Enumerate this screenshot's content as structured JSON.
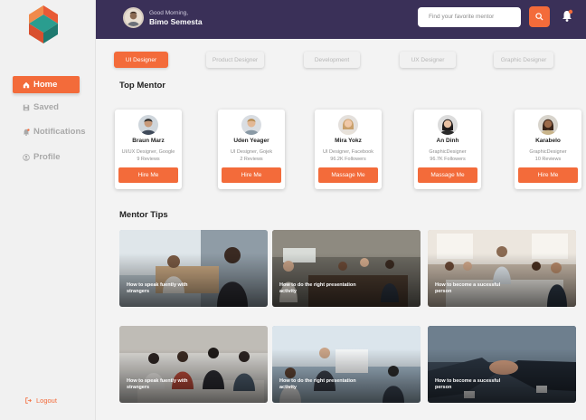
{
  "header": {
    "greeting": "Good Morning,",
    "user_name": "Bimo Semesta",
    "search_placeholder": "Find your favorite mentor"
  },
  "sidebar": {
    "items": [
      {
        "label": "Home",
        "icon": "home-icon",
        "active": true
      },
      {
        "label": "Saved",
        "icon": "save-icon",
        "active": false
      },
      {
        "label": "Notifications",
        "icon": "bell-icon",
        "active": false
      },
      {
        "label": "Profile",
        "icon": "user-icon",
        "active": false
      }
    ],
    "logout_label": "Logout"
  },
  "categories": [
    "UI Designer",
    "Product Designer",
    "Development",
    "UX Designer",
    "Graphic Designer"
  ],
  "top_mentor_title": "Top Mentor",
  "mentors": [
    {
      "name": "Braun Marz",
      "role": "UI/UX Designer, Google",
      "stat": "9 Reviews",
      "button": "Hire Me"
    },
    {
      "name": "Uden Yeager",
      "role": "UI Designer, Gojek",
      "stat": "2 Reviews",
      "button": "Hire Me"
    },
    {
      "name": "Mira Yokz",
      "role": "UI Designer, Facebook",
      "stat": "96.2K Followers",
      "button": "Massage Me"
    },
    {
      "name": "An Dinh",
      "role": "GraphicDesigner",
      "stat": "96.7K Followers",
      "button": "Massage Me"
    },
    {
      "name": "Karabelo",
      "role": "GraphicDesigner",
      "stat": "10 Reviews",
      "button": "Hire Me"
    }
  ],
  "mentor_tips_title": "Mentor Tips",
  "tips": [
    {
      "caption": "How to speak fuently with strangers"
    },
    {
      "caption": "How to do the right presentation activity"
    },
    {
      "caption": "How to become a sucessful person"
    },
    {
      "caption": "How to speak fuently with strangers"
    },
    {
      "caption": "How to do the right presentation activity"
    },
    {
      "caption": "How to become a sucessful person"
    }
  ],
  "colors": {
    "accent": "#f36b3a",
    "header": "#3a3058",
    "sidebar": "#f1f1f1"
  }
}
